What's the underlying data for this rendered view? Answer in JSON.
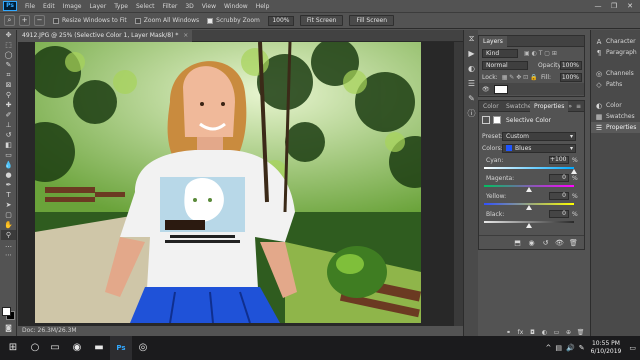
{
  "menubar": {
    "logo": "Ps",
    "items": [
      "File",
      "Edit",
      "Image",
      "Layer",
      "Type",
      "Select",
      "Filter",
      "3D",
      "View",
      "Window",
      "Help"
    ],
    "window_controls": [
      "—",
      "❐",
      "✕"
    ]
  },
  "options_bar": {
    "resize_windows_label": "Resize Windows to Fit",
    "resize_windows_checked": false,
    "zoom_all_label": "Zoom All Windows",
    "zoom_all_checked": false,
    "scrubby_zoom_label": "Scrubby Zoom",
    "scrubby_zoom_checked": true,
    "zoom_value": "100%",
    "fit_screen_label": "Fit Screen",
    "fill_screen_label": "Fill Screen"
  },
  "document": {
    "tab_title": "4912.JPG @ 25% (Selective Color 1, Layer Mask/8) *",
    "tab_close": "×",
    "status": "Doc: 26.3M/26.3M"
  },
  "layers_panel": {
    "tab": "Layers",
    "filter_kind": "Kind",
    "blend_mode": "Normal",
    "opacity_label": "Opacity:",
    "opacity_value": "100%",
    "lock_label": "Lock:",
    "fill_label": "Fill:",
    "fill_value": "100%"
  },
  "properties_panel": {
    "tabs": [
      "Color",
      "Swatches",
      "Properties"
    ],
    "active_tab": "Properties",
    "adjustment_title": "Selective Color",
    "preset_label": "Preset:",
    "preset_value": "Custom",
    "colors_label": "Colors:",
    "colors_value": "Blues",
    "blues_swatch": "#1f55ff",
    "sliders": [
      {
        "label": "Cyan:",
        "value": "+100",
        "pct": "%",
        "level": 100
      },
      {
        "label": "Magenta:",
        "value": "0",
        "pct": "%",
        "level": 0
      },
      {
        "label": "Yellow:",
        "value": "0",
        "pct": "%",
        "level": 0
      },
      {
        "label": "Black:",
        "value": "0",
        "pct": "%",
        "level": 0
      }
    ]
  },
  "right_dock": {
    "group1": [
      "Character",
      "Paragraph"
    ],
    "group2": [
      "Channels",
      "Paths"
    ],
    "group3": [
      "Color",
      "Swatches",
      "Properties"
    ],
    "active": "Properties"
  },
  "taskbar": {
    "time": "10:55 PM",
    "date": "6/10/2019"
  },
  "colors": {
    "ps_blue": "#31a8ff",
    "panel_bg": "#535353",
    "skirt_blue": "#1f52d8"
  }
}
